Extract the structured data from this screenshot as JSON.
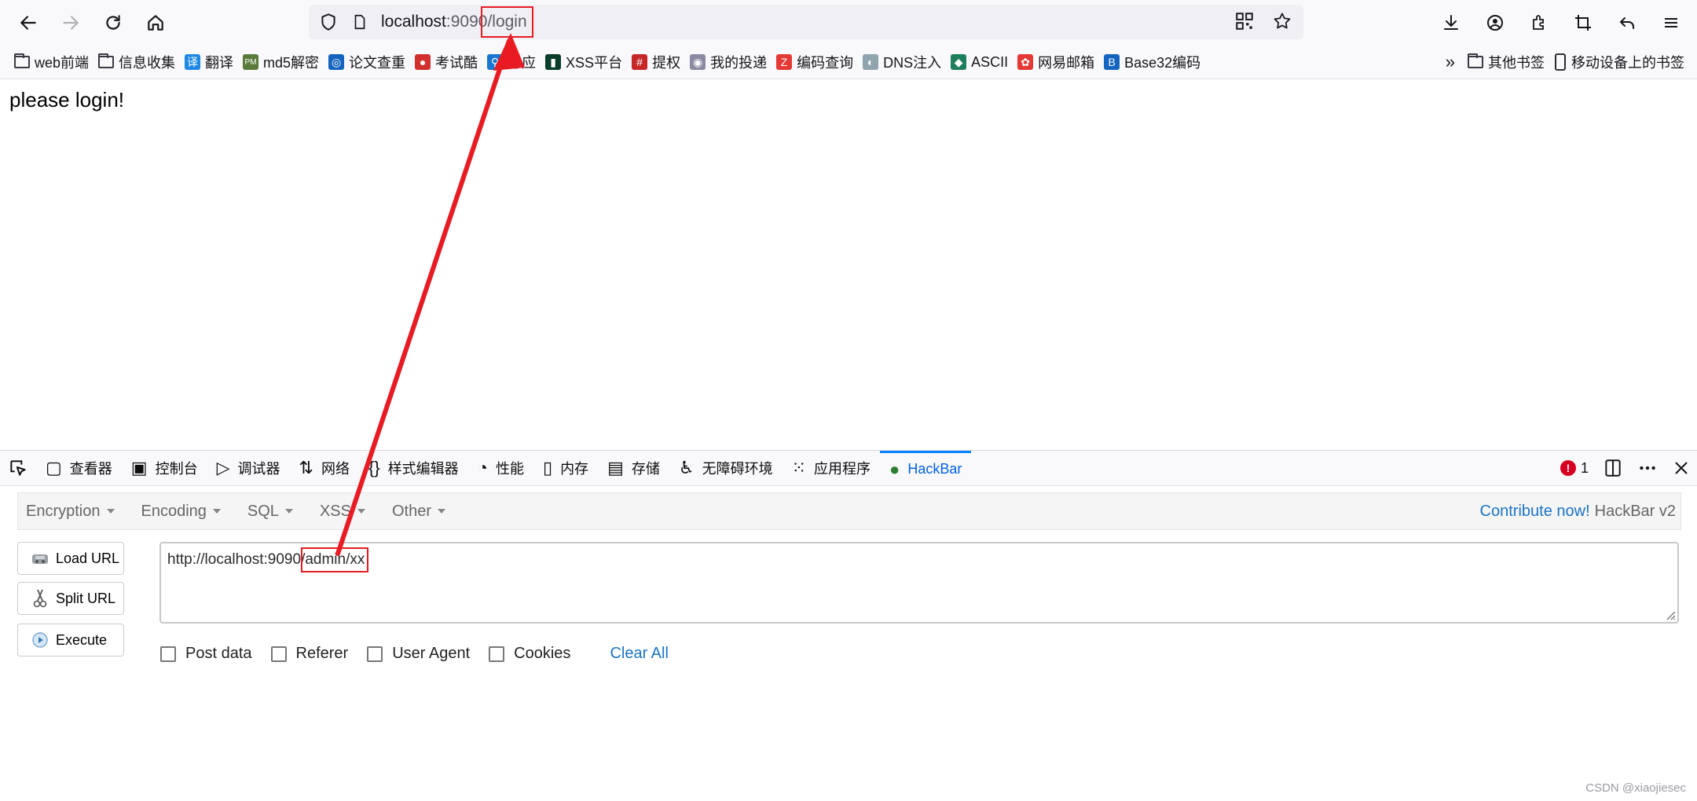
{
  "browser": {
    "address": {
      "host": "localhost",
      "port": ":9090",
      "path": "/login"
    }
  },
  "bookmarks": {
    "items": [
      {
        "label": "web前端",
        "icon": "folder-icon"
      },
      {
        "label": "信息收集",
        "icon": "folder-icon"
      },
      {
        "label": "翻译",
        "icon": "translate-icon",
        "color": "#1e88e5"
      },
      {
        "label": "md5解密",
        "icon": "pmd5-icon",
        "color": "#5a7a3a"
      },
      {
        "label": "论文查重",
        "icon": "paper-check-icon",
        "color": "#1565c0"
      },
      {
        "label": "考试酷",
        "icon": "exam-icon",
        "color": "#d32f2f"
      },
      {
        "label": "必应",
        "icon": "bing-icon",
        "color": "#1976d2"
      },
      {
        "label": "XSS平台",
        "icon": "xss-icon",
        "color": "#0a3d2a"
      },
      {
        "label": "提权",
        "icon": "grid-icon",
        "color": "#c62828"
      },
      {
        "label": "我的投递",
        "icon": "eye-icon",
        "color": "#8a8aa3"
      },
      {
        "label": "编码查询",
        "icon": "z-icon",
        "color": "#e53935"
      },
      {
        "label": "DNS注入",
        "icon": "dns-icon",
        "color": "#90a4ae"
      },
      {
        "label": "ASCII",
        "icon": "ascii-icon",
        "color": "#1e7f5c"
      },
      {
        "label": "网易邮箱",
        "icon": "netease-icon",
        "color": "#e53935"
      },
      {
        "label": "Base32编码",
        "icon": "b-icon",
        "color": "#1565c0"
      }
    ],
    "other_bookmarks": "其他书签",
    "mobile_bookmarks": "移动设备上的书签"
  },
  "page": {
    "text": "please login!"
  },
  "devtools": {
    "tabs": [
      {
        "label": "查看器",
        "icon": "inspector-icon"
      },
      {
        "label": "控制台",
        "icon": "console-icon"
      },
      {
        "label": "调试器",
        "icon": "debugger-icon"
      },
      {
        "label": "网络",
        "icon": "network-icon"
      },
      {
        "label": "样式编辑器",
        "icon": "style-editor-icon"
      },
      {
        "label": "性能",
        "icon": "performance-icon"
      },
      {
        "label": "内存",
        "icon": "memory-icon"
      },
      {
        "label": "存储",
        "icon": "storage-icon"
      },
      {
        "label": "无障碍环境",
        "icon": "accessibility-icon"
      },
      {
        "label": "应用程序",
        "icon": "application-icon"
      },
      {
        "label": "HackBar",
        "icon": "hackbar-icon",
        "active": true
      }
    ],
    "error_count": "1"
  },
  "hackbar": {
    "menu": [
      {
        "label": "Encryption"
      },
      {
        "label": "Encoding"
      },
      {
        "label": "SQL"
      },
      {
        "label": "XSS"
      },
      {
        "label": "Other"
      }
    ],
    "contribute": "Contribute now!",
    "version": "HackBar v2",
    "buttons": {
      "load_url": "Load URL",
      "split_url": "Split URL",
      "execute": "Execute"
    },
    "url": {
      "prefix": "http://localhost:9090/",
      "highlight": "admin/xx"
    },
    "options": {
      "post_data": "Post data",
      "referer": "Referer",
      "user_agent": "User Agent",
      "cookies": "Cookies"
    },
    "clear_all": "Clear All"
  },
  "watermark": "CSDN @xiaojiesec",
  "colors": {
    "annotation_red": "#e81b23",
    "link_blue": "#1a73c7",
    "active_tab_blue": "#0060df"
  }
}
